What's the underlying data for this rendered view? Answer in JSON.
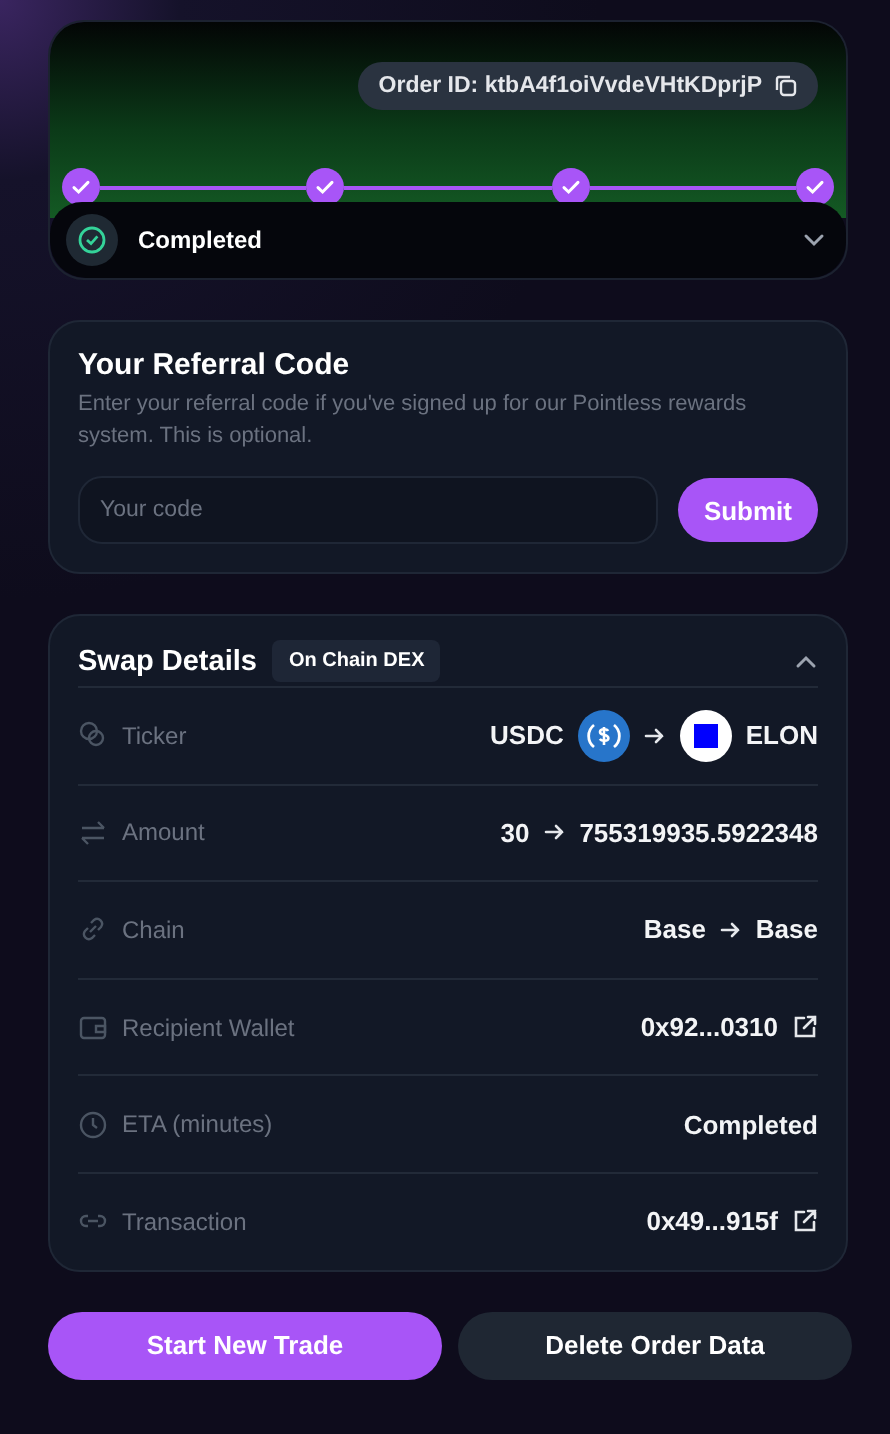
{
  "order": {
    "id_label": "Order ID: ktbA4f1oiVvdeVHtKDprjP",
    "steps": [
      {
        "done": true
      },
      {
        "done": true
      },
      {
        "done": true
      },
      {
        "done": true
      }
    ],
    "status": "Completed",
    "expanded": false
  },
  "referral": {
    "title": "Your Referral Code",
    "description": "Enter your referral code if you've signed up for our Pointless rewards system. This is optional.",
    "placeholder": "Your code",
    "button": "Submit"
  },
  "swap": {
    "title": "Swap Details",
    "badge": "On Chain DEX",
    "expanded": true,
    "rows": [
      {
        "kind": "ticker",
        "label": "Ticker",
        "from": "USDC",
        "to": "ELON"
      },
      {
        "kind": "pair",
        "label": "Amount",
        "from": "30",
        "to": "755319935.5922348"
      },
      {
        "kind": "pair",
        "label": "Chain",
        "from": "Base",
        "to": "Base"
      },
      {
        "kind": "link",
        "label": "Recipient Wallet",
        "value": "0x92...0310"
      },
      {
        "kind": "text",
        "label": "ETA (minutes)",
        "value": "Completed"
      },
      {
        "kind": "link",
        "label": "Transaction",
        "value": "0x49...915f"
      }
    ]
  },
  "buttons": [
    {
      "kind": "primary",
      "label": "Start New Trade"
    },
    {
      "kind": "secondary",
      "label": "Delete Order Data"
    }
  ]
}
